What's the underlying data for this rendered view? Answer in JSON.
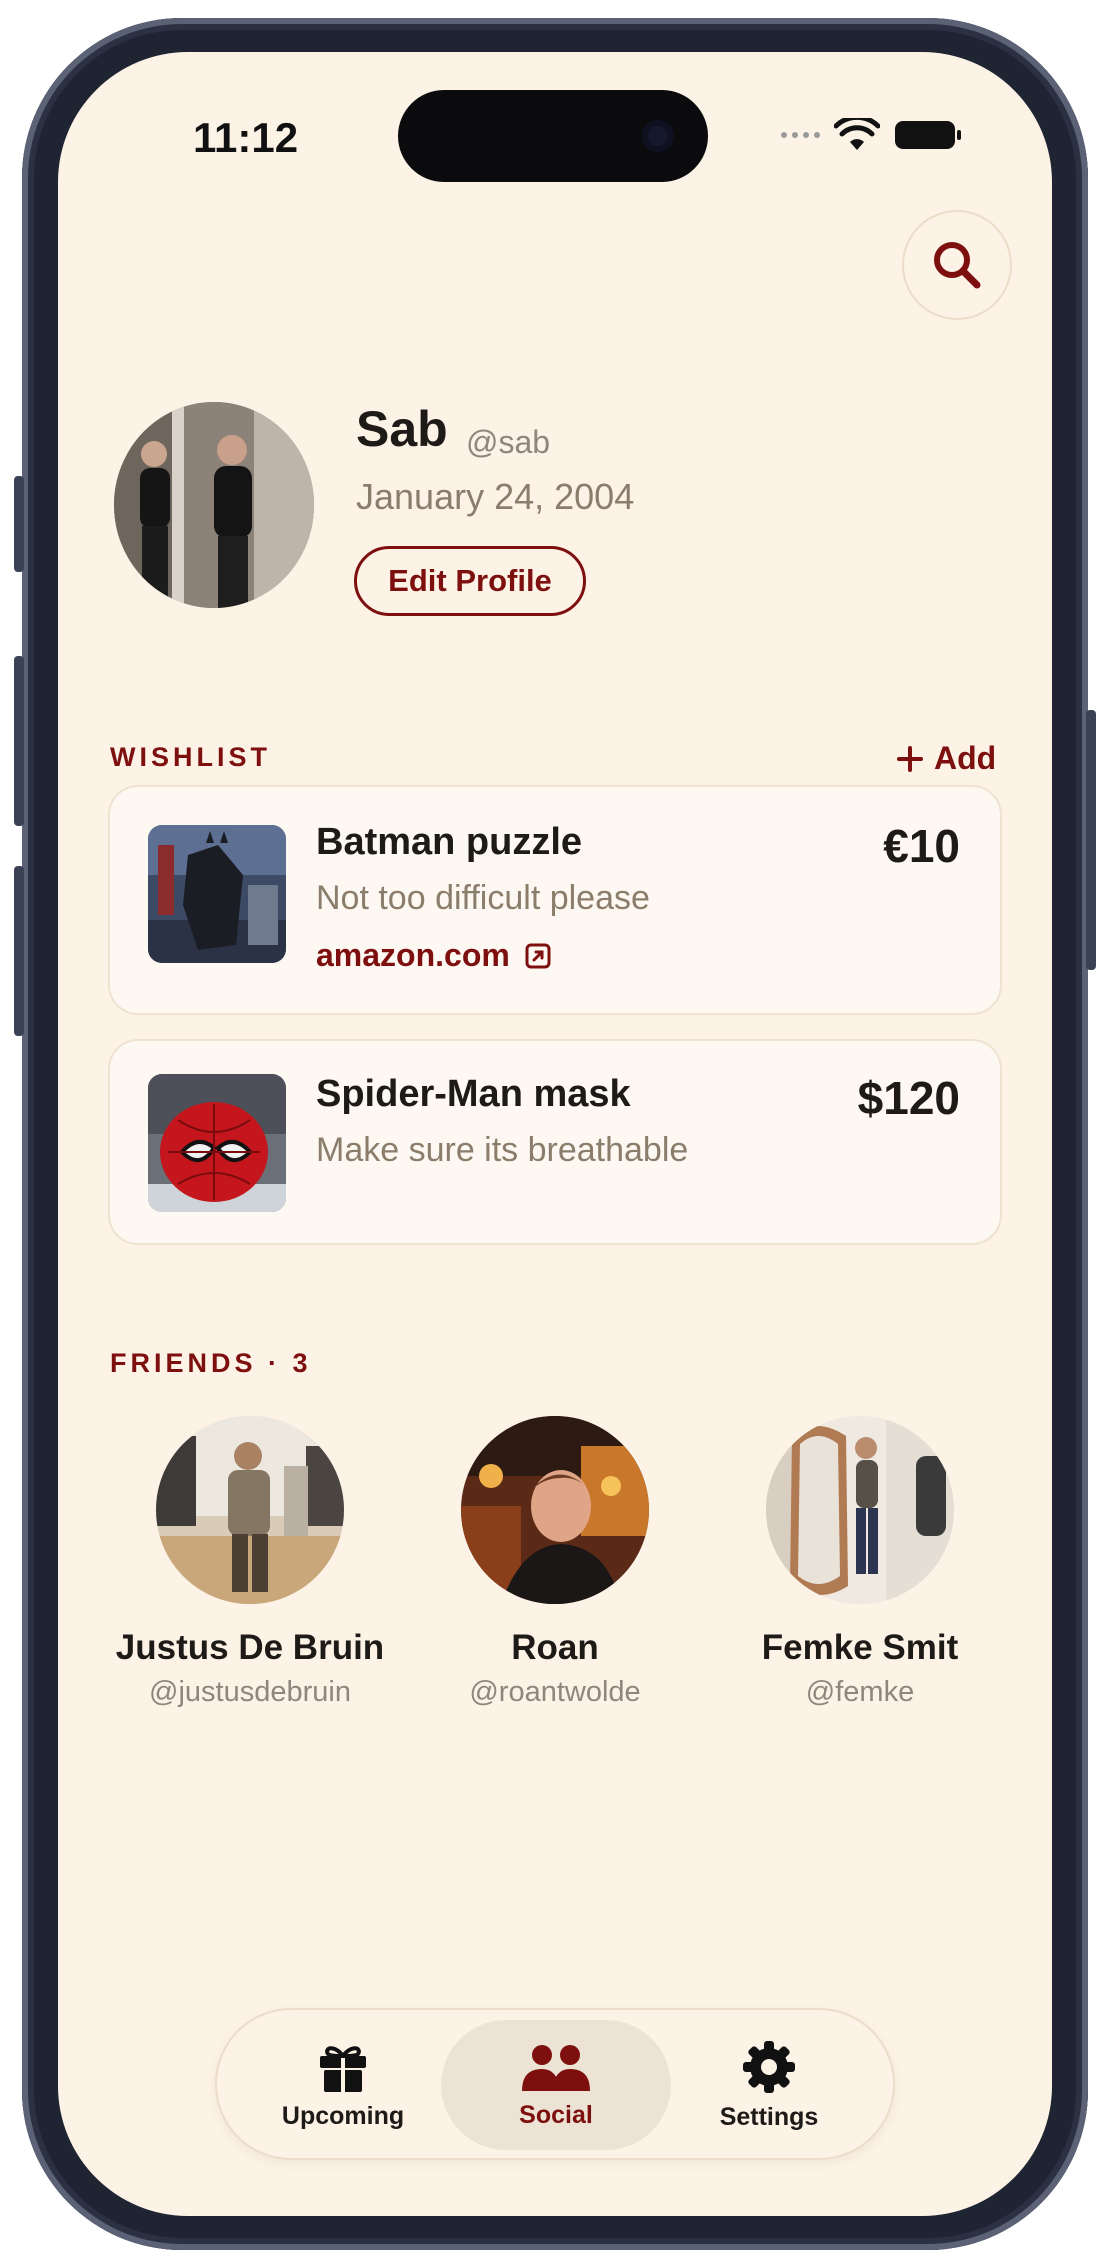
{
  "status_bar": {
    "time": "11:12"
  },
  "profile": {
    "name": "Sab",
    "handle": "@sab",
    "birthday": "January 24, 2004",
    "edit_label": "Edit Profile"
  },
  "wishlist": {
    "label": "WISHLIST",
    "add_label": "Add",
    "items": [
      {
        "title": "Batman puzzle",
        "note": "Not too difficult please",
        "price": "€10",
        "link": "amazon.com"
      },
      {
        "title": "Spider-Man mask",
        "note": "Make sure its breathable",
        "price": "$120"
      }
    ]
  },
  "friends": {
    "label": "FRIENDS · 3",
    "items": [
      {
        "name": "Justus De Bruin",
        "handle": "@justusdebruin"
      },
      {
        "name": "Roan",
        "handle": "@roantwolde"
      },
      {
        "name": "Femke Smit",
        "handle": "@femke"
      }
    ]
  },
  "tabbar": {
    "tabs": [
      {
        "label": "Upcoming",
        "icon": "gift-icon"
      },
      {
        "label": "Social",
        "icon": "people-icon",
        "active": true
      },
      {
        "label": "Settings",
        "icon": "gear-icon"
      }
    ]
  },
  "colors": {
    "accent": "#7d0f0f",
    "background": "#fcf3e6",
    "card": "#fdf8f1"
  }
}
